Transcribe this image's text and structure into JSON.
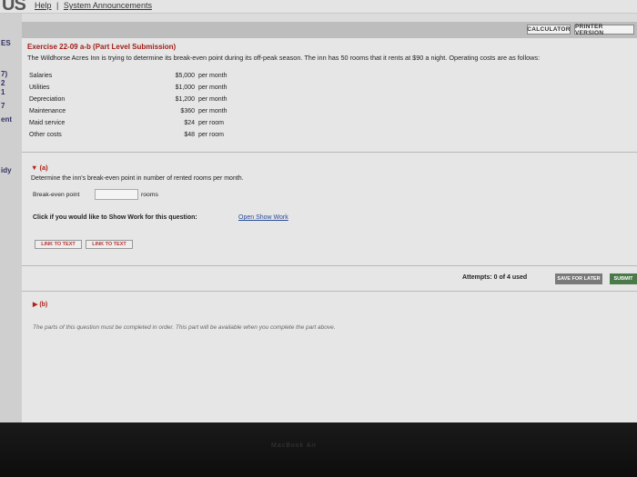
{
  "header": {
    "logo_fragment": "US",
    "help_link": "Help",
    "separator": "|",
    "announcements_link": "System Announcements"
  },
  "left_fragments": [
    "ES",
    "7)",
    "2",
    "1",
    "7",
    "ent",
    "idy"
  ],
  "toolbar": {
    "calculator_label": "CALCULATOR",
    "printer_label": "PRINTER VERSION"
  },
  "exercise": {
    "title": "Exercise 22-09 a-b (Part Level Submission)",
    "prompt": "The Wildhorse Acres Inn is trying to determine its break-even point during its off-peak season. The inn has 50 rooms that it rents at $90 a night. Operating costs are as follows:",
    "costs": [
      {
        "label": "Salaries",
        "amount": "$5,000",
        "unit": "per month"
      },
      {
        "label": "Utilities",
        "amount": "$1,000",
        "unit": "per month"
      },
      {
        "label": "Depreciation",
        "amount": "$1,200",
        "unit": "per month"
      },
      {
        "label": "Maintenance",
        "amount": "$360",
        "unit": "per month"
      },
      {
        "label": "Maid service",
        "amount": "$24",
        "unit": "per room"
      },
      {
        "label": "Other costs",
        "amount": "$48",
        "unit": "per room"
      }
    ]
  },
  "part_a": {
    "heading": "▼ (a)",
    "question": "Determine the inn's break-even point in number of rented rooms per month.",
    "break_even_label": "Break-even point",
    "break_even_value": "",
    "unit": "rooms",
    "show_work_question": "Click if you would like to Show Work for this question:",
    "show_work_link": "Open Show Work",
    "link_buttons": [
      "LINK TO TEXT",
      "LINK TO TEXT"
    ]
  },
  "attempts": {
    "text": "Attempts: 0 of 4 used",
    "save_label": "SAVE FOR LATER",
    "submit_label": "SUBMIT"
  },
  "part_b": {
    "heading": "▶ (b)",
    "note": "The parts of this question must be completed in order. This part will be available when you complete the part above."
  },
  "bezel_text": "MacBook Air"
}
